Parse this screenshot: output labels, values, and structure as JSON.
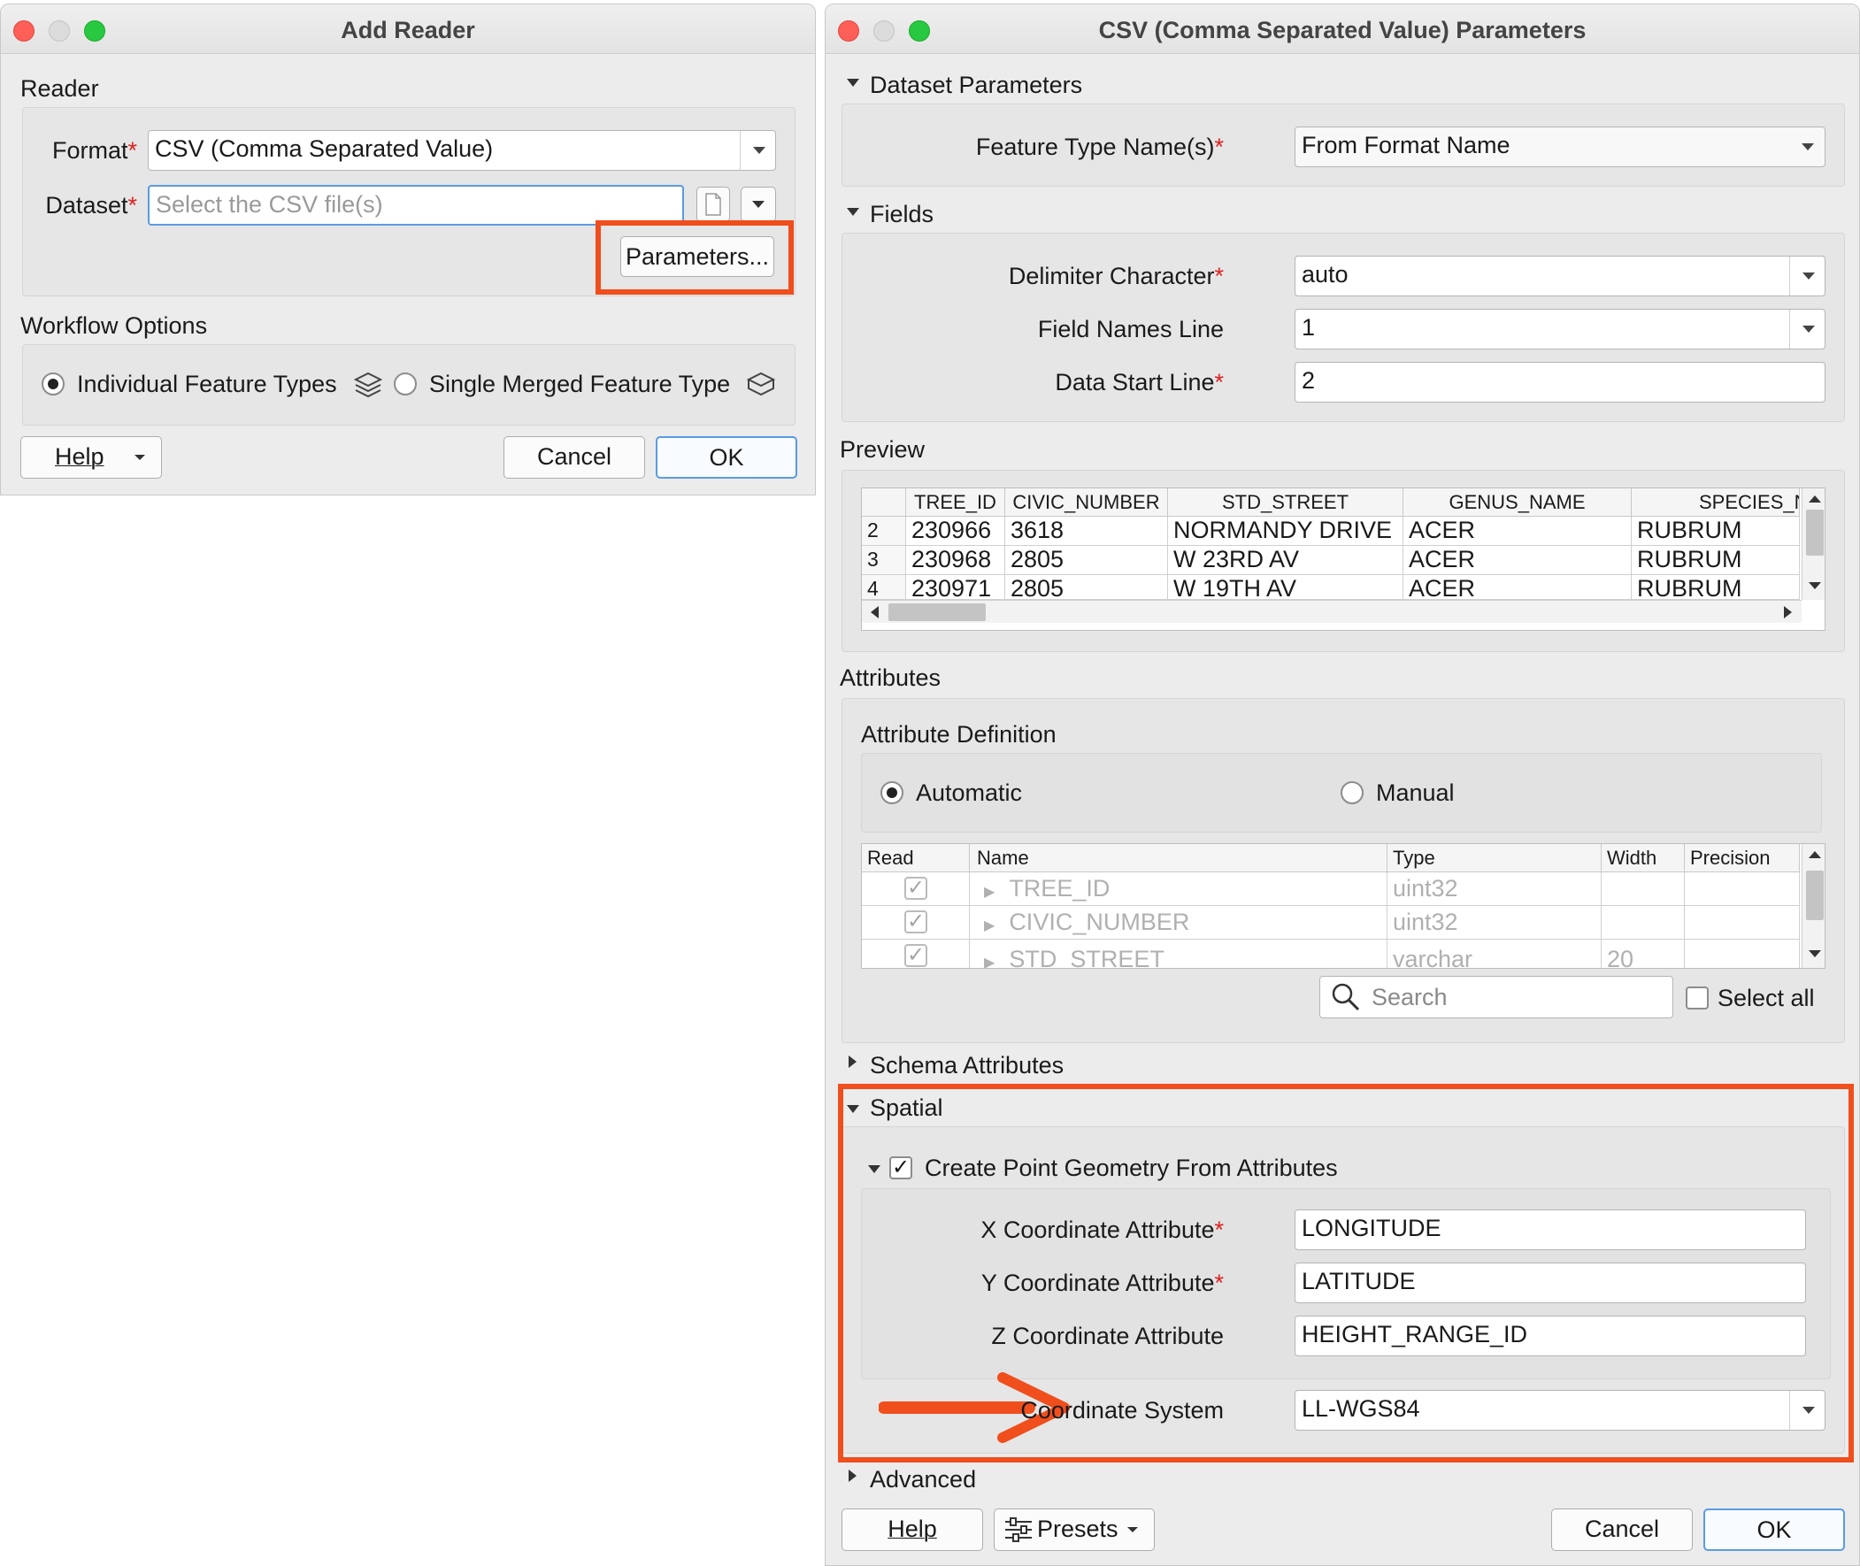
{
  "add_reader": {
    "title": "Add Reader",
    "reader_section": "Reader",
    "format_label": "Format",
    "format_value": "CSV (Comma Separated Value)",
    "dataset_label": "Dataset",
    "dataset_placeholder": "Select the CSV file(s)",
    "parameters_button": "Parameters...",
    "workflow_section": "Workflow Options",
    "individual_label": "Individual Feature Types",
    "single_label": "Single Merged Feature Type",
    "help_button": "Help",
    "cancel_button": "Cancel",
    "ok_button": "OK"
  },
  "csv_params": {
    "title": "CSV (Comma Separated Value) Parameters",
    "dataset_parameters": "Dataset Parameters",
    "feature_type_label": "Feature Type Name(s)",
    "feature_type_value": "From Format Name",
    "fields_section": "Fields",
    "delimiter_label": "Delimiter Character",
    "delimiter_value": "auto",
    "field_names_label": "Field Names Line",
    "field_names_value": "1",
    "data_start_label": "Data Start Line",
    "data_start_value": "2",
    "preview_section": "Preview",
    "preview": {
      "headers": [
        "TREE_ID",
        "CIVIC_NUMBER",
        "STD_STREET",
        "GENUS_NAME",
        "SPECIES_N"
      ],
      "rows": [
        {
          "num": "2",
          "cells": [
            "230966",
            "3618",
            "NORMANDY DRIVE",
            "ACER",
            "RUBRUM"
          ]
        },
        {
          "num": "3",
          "cells": [
            "230968",
            "2805",
            "W 23RD AV",
            "ACER",
            "RUBRUM"
          ]
        },
        {
          "num": "4",
          "cells": [
            "230971",
            "2805",
            "W 19TH AV",
            "ACER",
            "RUBRUM"
          ]
        }
      ]
    },
    "attributes_section": "Attributes",
    "attribute_definition": "Attribute Definition",
    "automatic_label": "Automatic",
    "manual_label": "Manual",
    "attr_table": {
      "headers": [
        "Read",
        "Name",
        "Type",
        "Width",
        "Precision"
      ],
      "rows": [
        {
          "name": "TREE_ID",
          "type": "uint32",
          "width": ""
        },
        {
          "name": "CIVIC_NUMBER",
          "type": "uint32",
          "width": ""
        },
        {
          "name": "STD_STREET",
          "type": "varchar",
          "width": "20"
        }
      ]
    },
    "search_placeholder": "Search",
    "select_all": "Select all",
    "schema_attributes": "Schema Attributes",
    "spatial_section": "Spatial",
    "create_point_label": "Create Point Geometry From Attributes",
    "x_label": "X Coordinate Attribute",
    "x_value": "LONGITUDE",
    "y_label": "Y Coordinate Attribute",
    "y_value": "LATITUDE",
    "z_label": "Z Coordinate Attribute",
    "z_value": "HEIGHT_RANGE_ID",
    "coord_sys_label": "Coordinate System",
    "coord_sys_value": "LL-WGS84",
    "advanced_section": "Advanced",
    "help_button": "Help",
    "presets_button": "Presets",
    "cancel_button": "Cancel",
    "ok_button": "OK"
  },
  "colors": {
    "highlight": "#f04e1c",
    "required_star": "#e02020",
    "default_button": "#5b9be0"
  },
  "icons": [
    "layers-icon",
    "layers-single-icon",
    "file-icon",
    "search-icon",
    "sliders-icon",
    "arrow-icon"
  ]
}
